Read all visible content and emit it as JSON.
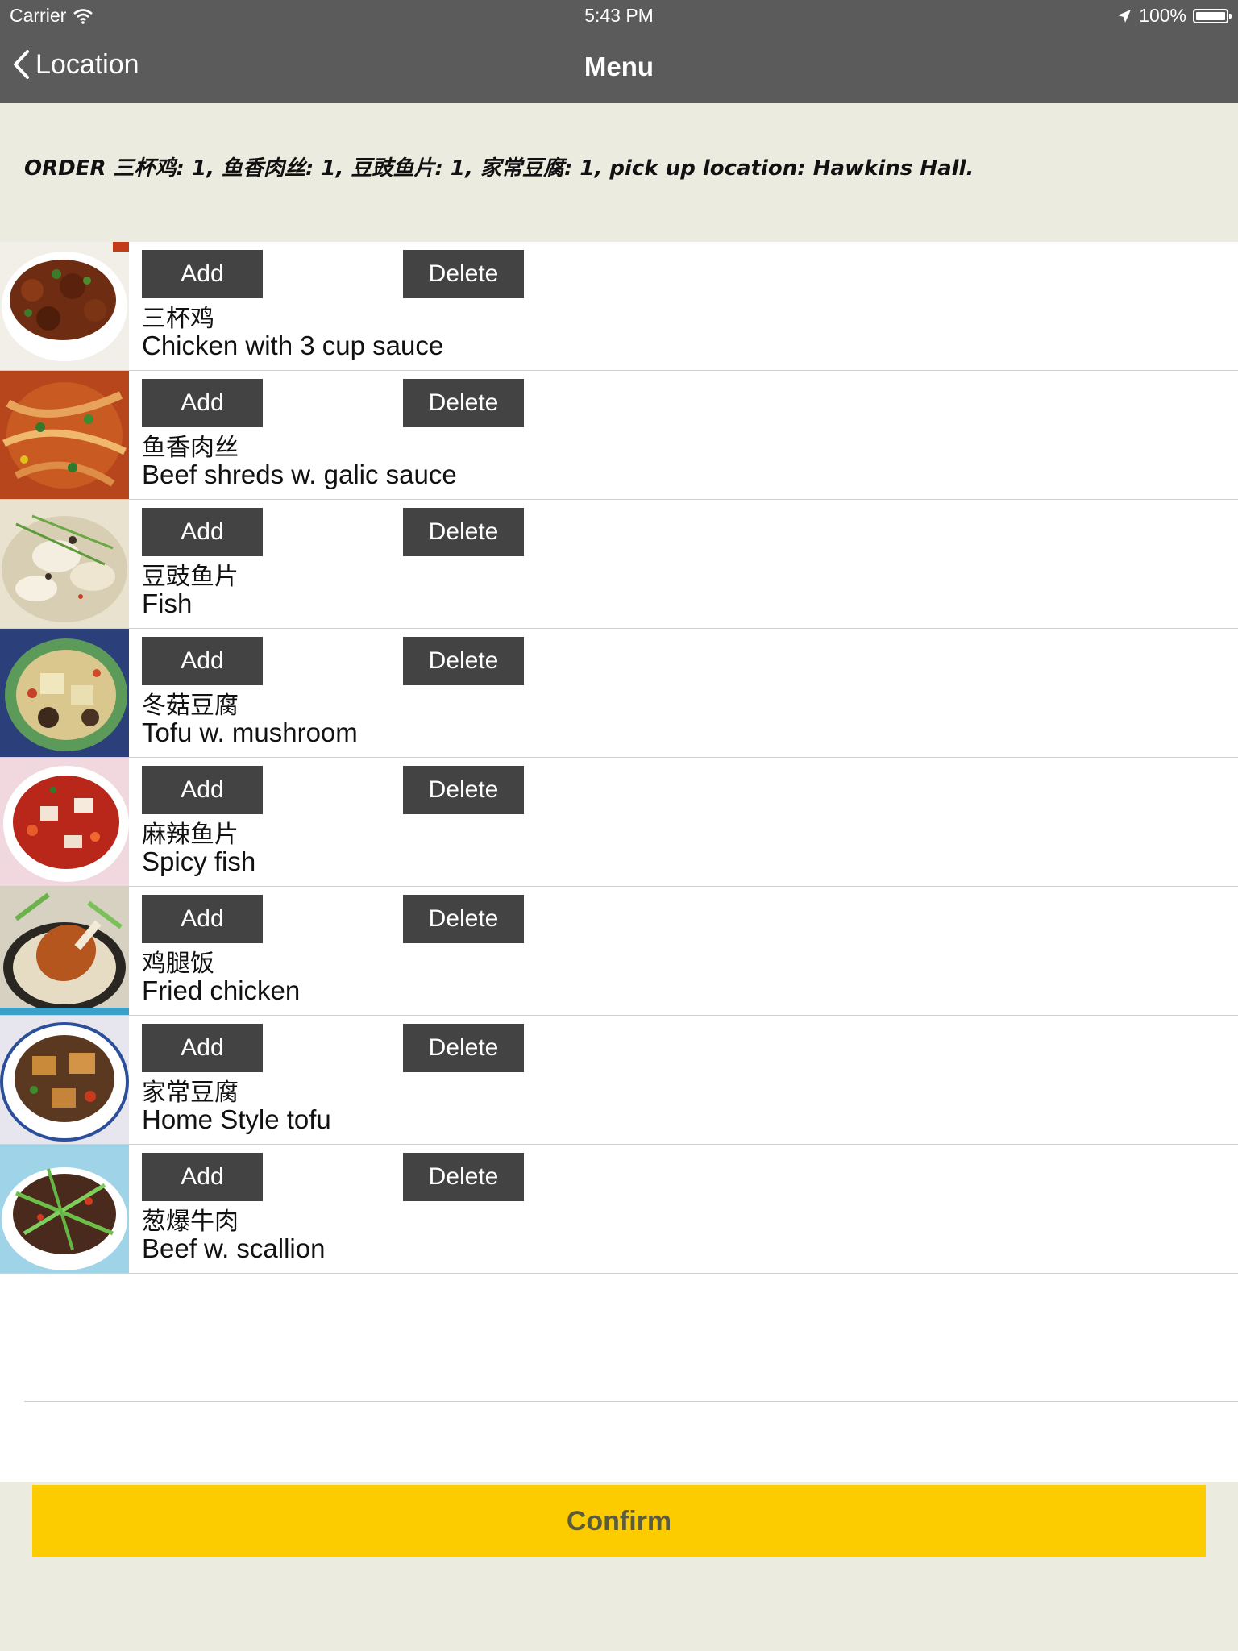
{
  "status_bar": {
    "carrier": "Carrier",
    "time": "5:43 PM",
    "battery": "100%"
  },
  "nav": {
    "back_label": "Location",
    "title": "Menu"
  },
  "order_summary": "ORDER 三杯鸡: 1, 鱼香肉丝: 1, 豆豉鱼片: 1, 家常豆腐: 1, pick up location: Hawkins Hall.",
  "menu_items": [
    {
      "add_label": "Add",
      "delete_label": "Delete",
      "name_zh": "三杯鸡",
      "name_en": "Chicken with 3 cup sauce"
    },
    {
      "add_label": "Add",
      "delete_label": "Delete",
      "name_zh": "鱼香肉丝",
      "name_en": "Beef shreds w. galic sauce"
    },
    {
      "add_label": "Add",
      "delete_label": "Delete",
      "name_zh": "豆豉鱼片",
      "name_en": "Fish"
    },
    {
      "add_label": "Add",
      "delete_label": "Delete",
      "name_zh": "冬菇豆腐",
      "name_en": "Tofu w. mushroom"
    },
    {
      "add_label": "Add",
      "delete_label": "Delete",
      "name_zh": "麻辣鱼片",
      "name_en": "Spicy fish"
    },
    {
      "add_label": "Add",
      "delete_label": "Delete",
      "name_zh": "鸡腿饭",
      "name_en": "Fried chicken"
    },
    {
      "add_label": "Add",
      "delete_label": "Delete",
      "name_zh": "家常豆腐",
      "name_en": "Home Style tofu"
    },
    {
      "add_label": "Add",
      "delete_label": "Delete",
      "name_zh": "葱爆牛肉",
      "name_en": "Beef w. scallion"
    }
  ],
  "confirm_label": "Confirm",
  "colors": {
    "nav_bar": "#5b5b5b",
    "background": "#ebebdf",
    "button": "#434343",
    "confirm": "#fdcc00"
  }
}
